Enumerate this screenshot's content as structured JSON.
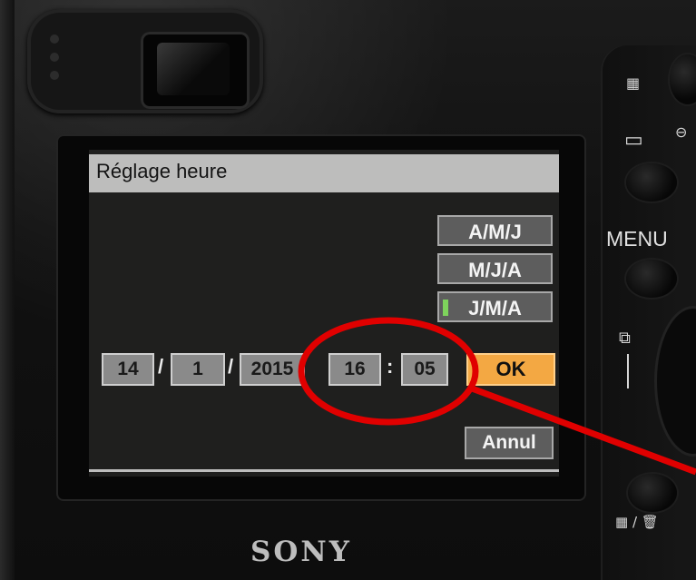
{
  "lcd": {
    "title": "Réglage heure",
    "format_options": [
      {
        "label": "A/M/J",
        "selected": false
      },
      {
        "label": "M/J/A",
        "selected": false
      },
      {
        "label": "J/M/A",
        "selected": true
      }
    ],
    "date": {
      "day": "14",
      "month": "1",
      "year": "2015",
      "separator": "/"
    },
    "time": {
      "hour": "16",
      "minute": "05",
      "separator": ":"
    },
    "ok_label": "OK",
    "cancel_label": "Annul"
  },
  "camera": {
    "brand": "SONY",
    "menu_label": "MENU"
  },
  "colors": {
    "ok_button": "#f3a843",
    "annotation": "#e00000",
    "selection_indicator": "#7ed35c"
  }
}
